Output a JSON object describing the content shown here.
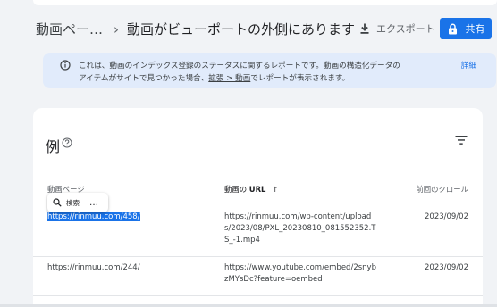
{
  "header": {
    "breadcrumb_root": "動画ペー…",
    "breadcrumb_separator": "›",
    "title": "動画がビューポートの外側にあります",
    "export_label": "エクスポート",
    "share_label": "共有"
  },
  "notice": {
    "line1": "これは、動画のインデックス登録のステータスに関するレポートです。動画の構造化データの",
    "line2_prefix": "アイテムがサイトで見つかった場合、",
    "line2_link": "拡張 > 動画",
    "line2_suffix": "でレポートが表示されます。",
    "details_label": "詳細"
  },
  "card": {
    "title": "例"
  },
  "table": {
    "columns": {
      "page": "動画ページ",
      "url_prefix": "動画の",
      "url_bold": "URL",
      "sort_arrow": "↑",
      "last_crawl": "前回のクロール"
    },
    "rows": [
      {
        "page": "https://rinmuu.com/458/",
        "video_url": "https://rinmuu.com/wp-content/uploads/2023/08/PXL_20230810_081552352.TS_-1.mp4",
        "last_crawl": "2023/09/02",
        "selected": true
      },
      {
        "page": "https://rinmuu.com/244/",
        "video_url": "https://www.youtube.com/embed/2snybzMYsDc?feature=oembed",
        "last_crawl": "2023/09/02",
        "selected": false
      }
    ]
  },
  "selection_toolbar": {
    "search_label": "検索",
    "more_label": "…"
  },
  "colors": {
    "accent": "#1a73e8",
    "notice_bg": "#e1ebfb",
    "page_bg": "#f1f3f6"
  }
}
